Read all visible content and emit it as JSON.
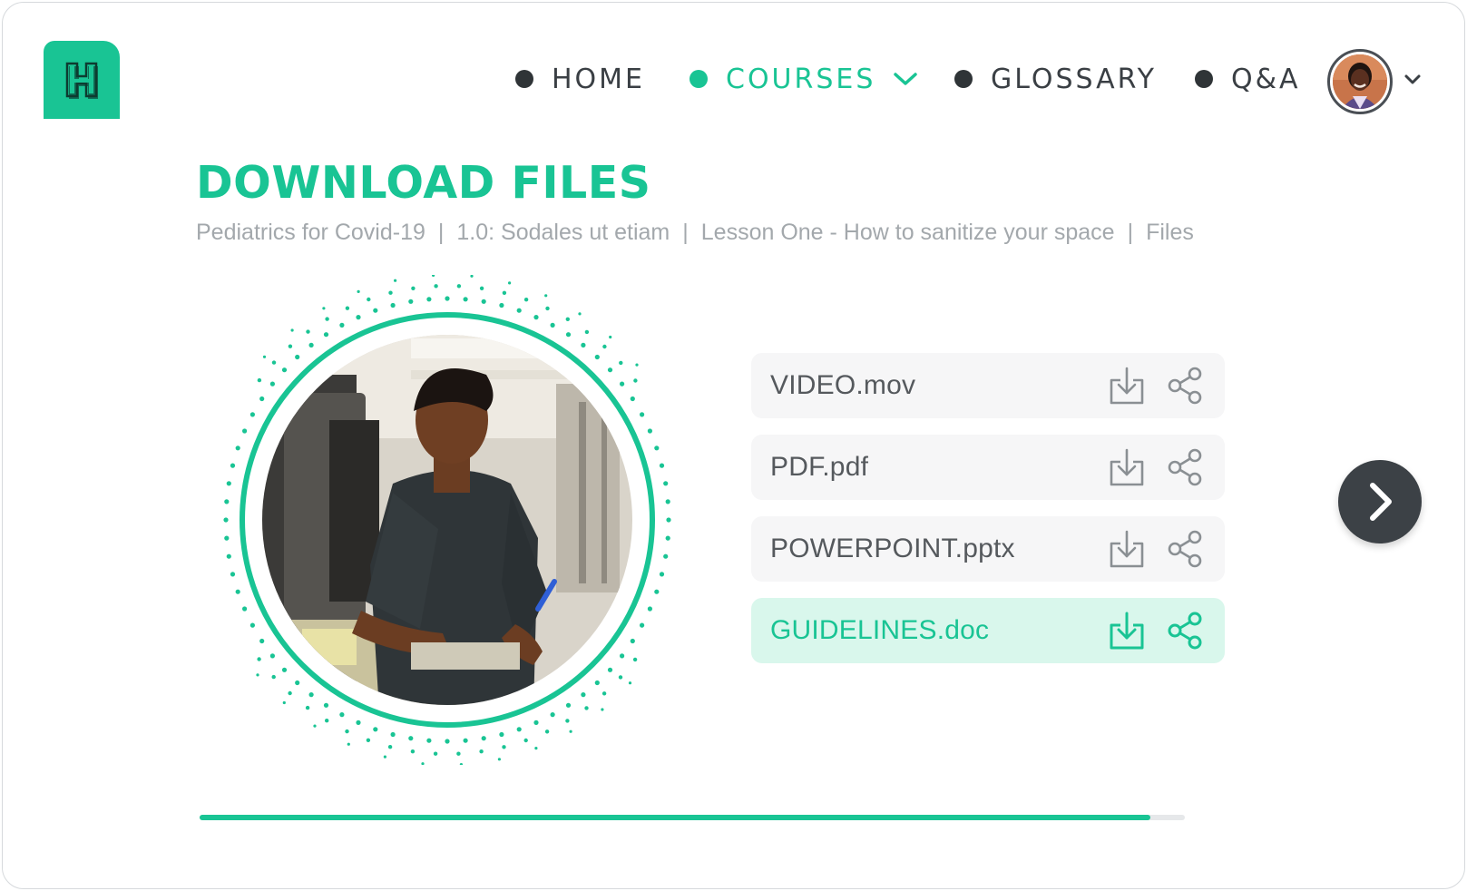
{
  "app": {
    "logo_letter": "H"
  },
  "nav": {
    "items": [
      {
        "label": "HOME",
        "active": false
      },
      {
        "label": "COURSES",
        "active": true,
        "has_dropdown": true
      },
      {
        "label": "GLOSSARY",
        "active": false
      },
      {
        "label": "Q&A",
        "active": false
      }
    ]
  },
  "user": {
    "avatar_icon": "user-avatar",
    "menu_icon": "chevron-down-icon"
  },
  "page": {
    "title": "DOWNLOAD FILES",
    "breadcrumb": [
      "Pediatrics for Covid-19",
      "1.0: Sodales ut etiam",
      "Lesson One - How to sanitize your space",
      "Files"
    ],
    "breadcrumb_separator": "|"
  },
  "files": [
    {
      "name": "VIDEO.mov",
      "highlighted": false
    },
    {
      "name": "PDF.pdf",
      "highlighted": false
    },
    {
      "name": "POWERPOINT.pptx",
      "highlighted": false
    },
    {
      "name": "GUIDELINES.doc",
      "highlighted": true
    }
  ],
  "file_actions": {
    "download_icon": "download-icon",
    "share_icon": "share-icon"
  },
  "next": {
    "icon": "chevron-right-icon"
  },
  "progress": {
    "percent": 96.5
  },
  "colors": {
    "accent": "#19c494",
    "accent_light": "#d9f7ec",
    "dark": "#3c4146",
    "muted_text": "#a3a8ac"
  }
}
